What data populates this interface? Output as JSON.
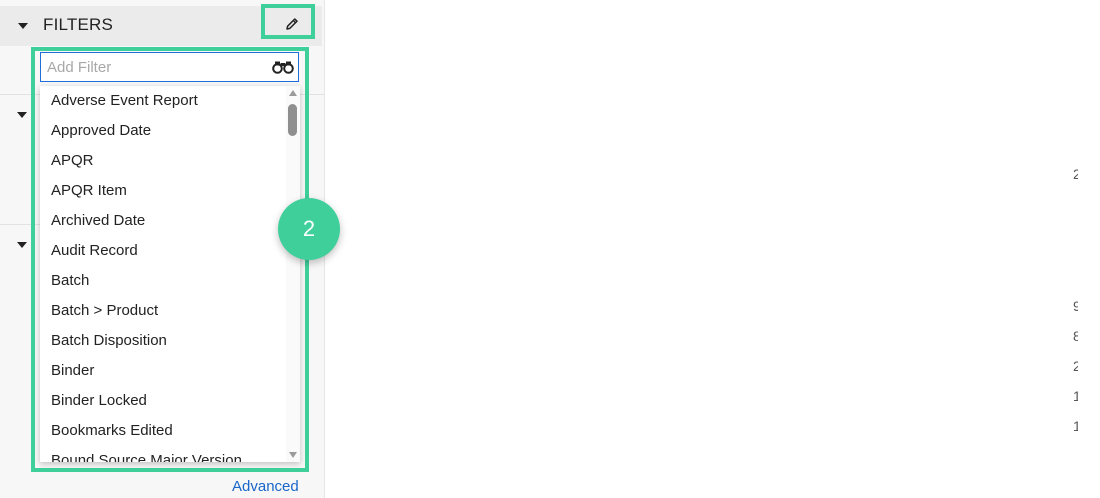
{
  "filters_panel": {
    "title": "FILTERS",
    "search": {
      "placeholder": "Add Filter",
      "value": ""
    },
    "options": [
      "Adverse Event Report",
      "Approved Date",
      "APQR",
      "APQR Item",
      "Archived Date",
      "Audit Record",
      "Batch",
      "Batch > Product",
      "Batch Disposition",
      "Binder",
      "Binder Locked",
      "Bookmarks Edited",
      "Bound Source Major Version"
    ],
    "advanced_link": "Advanced"
  },
  "callout": {
    "number": "2"
  },
  "background_peek": [
    "2",
    "9",
    "8",
    "2",
    "1",
    "1"
  ],
  "colors": {
    "highlight": "#3ecf9a",
    "link": "#1a66c9",
    "input_border": "#1e6fd6"
  }
}
